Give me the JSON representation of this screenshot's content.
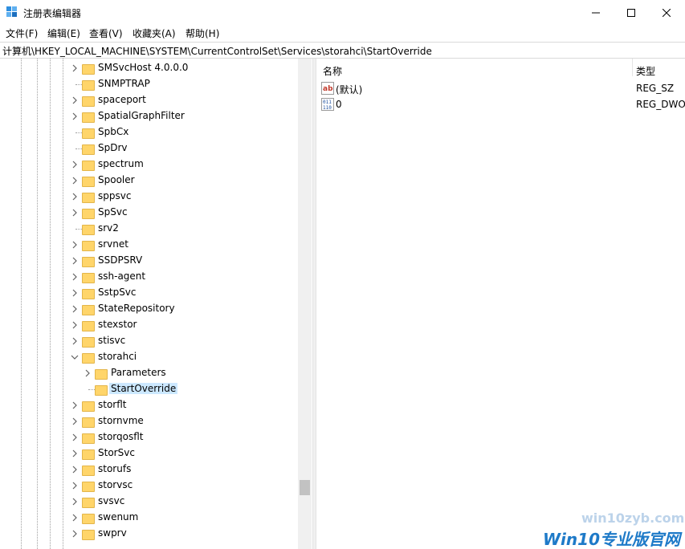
{
  "window": {
    "title": "注册表编辑器",
    "controls": {
      "minimize": "—",
      "maximize": "☐",
      "close": "✕"
    }
  },
  "menu": [
    "文件(F)",
    "编辑(E)",
    "查看(V)",
    "收藏夹(A)",
    "帮助(H)"
  ],
  "address": "计算机\\HKEY_LOCAL_MACHINE\\SYSTEM\\CurrentControlSet\\Services\\storahci\\StartOverride",
  "tree": {
    "items": [
      {
        "label": "SMSvcHost 4.0.0.0",
        "expandable": true
      },
      {
        "label": "SNMPTRAP",
        "expandable": false
      },
      {
        "label": "spaceport",
        "expandable": true
      },
      {
        "label": "SpatialGraphFilter",
        "expandable": true
      },
      {
        "label": "SpbCx",
        "expandable": false
      },
      {
        "label": "SpDrv",
        "expandable": false
      },
      {
        "label": "spectrum",
        "expandable": true
      },
      {
        "label": "Spooler",
        "expandable": true
      },
      {
        "label": "sppsvc",
        "expandable": true
      },
      {
        "label": "SpSvc",
        "expandable": true
      },
      {
        "label": "srv2",
        "expandable": false
      },
      {
        "label": "srvnet",
        "expandable": true
      },
      {
        "label": "SSDPSRV",
        "expandable": true
      },
      {
        "label": "ssh-agent",
        "expandable": true
      },
      {
        "label": "SstpSvc",
        "expandable": true
      },
      {
        "label": "StateRepository",
        "expandable": true
      },
      {
        "label": "stexstor",
        "expandable": true
      },
      {
        "label": "stisvc",
        "expandable": true
      },
      {
        "label": "storahci",
        "expandable": true,
        "expanded": true
      },
      {
        "label": "Parameters",
        "expandable": true,
        "child": true
      },
      {
        "label": "StartOverride",
        "expandable": false,
        "child": true,
        "selected": true
      },
      {
        "label": "storflt",
        "expandable": true
      },
      {
        "label": "stornvme",
        "expandable": true
      },
      {
        "label": "storqosflt",
        "expandable": true
      },
      {
        "label": "StorSvc",
        "expandable": true
      },
      {
        "label": "storufs",
        "expandable": true
      },
      {
        "label": "storvsc",
        "expandable": true
      },
      {
        "label": "svsvc",
        "expandable": true
      },
      {
        "label": "swenum",
        "expandable": true
      },
      {
        "label": "swprv",
        "expandable": true
      }
    ]
  },
  "values": {
    "columns": {
      "name": "名称",
      "type": "类型"
    },
    "rows": [
      {
        "icon": "string-value-icon",
        "name": "(默认)",
        "type": "REG_SZ"
      },
      {
        "icon": "dword-value-icon",
        "name": "0",
        "type": "REG_DWORD"
      }
    ]
  },
  "watermark": {
    "top": "win10zyb.com",
    "main": "Win10专业版官网"
  },
  "colors": {
    "selection": "#cce8ff",
    "folder": "#ffd56a",
    "watermark": "#1e7ac8"
  }
}
